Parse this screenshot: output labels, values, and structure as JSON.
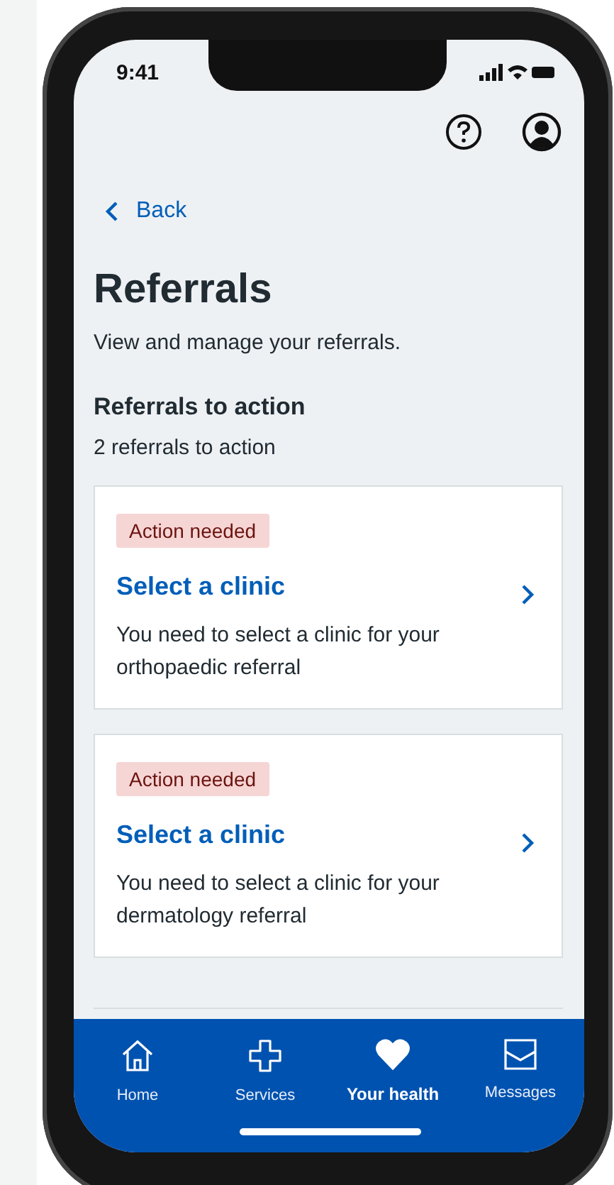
{
  "status_bar": {
    "time": "9:41"
  },
  "back_link": "Back",
  "page": {
    "title": "Referrals",
    "subtitle": "View and manage your referrals."
  },
  "section": {
    "heading": "Referrals to action",
    "count": "2 referrals to action"
  },
  "referrals": [
    {
      "tag": "Action needed",
      "title": "Select a clinic",
      "description": "You need to select a clinic for your orthopaedic referral"
    },
    {
      "tag": "Action needed",
      "title": "Select a clinic",
      "description": "You need to select a clinic for your dermatology referral"
    }
  ],
  "tab_bar": [
    {
      "label": "Home",
      "kind": "home",
      "selected": false
    },
    {
      "label": "Services",
      "kind": "services",
      "selected": false
    },
    {
      "label": "Your health",
      "kind": "health",
      "selected": true
    },
    {
      "label": "Messages",
      "kind": "messages",
      "selected": false
    }
  ]
}
